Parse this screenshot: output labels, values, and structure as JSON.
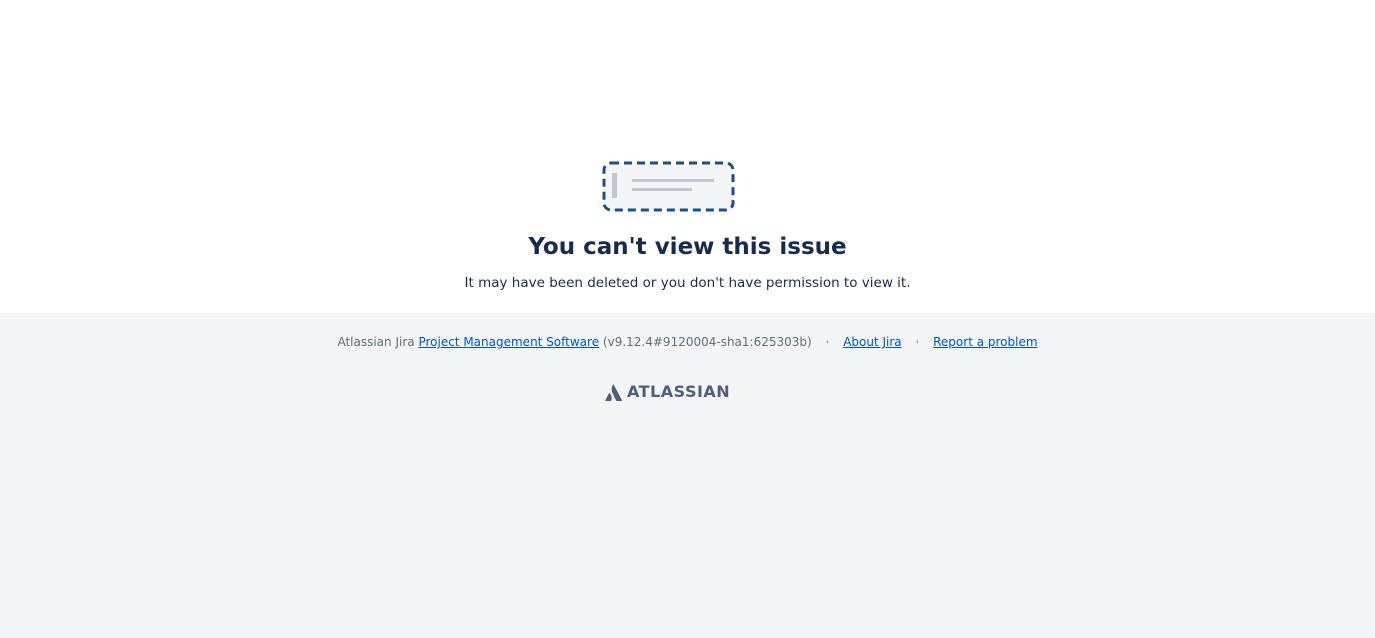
{
  "error": {
    "title": "You can't view this issue",
    "message": "It may have been deleted or you don't have permission to view it."
  },
  "footer": {
    "prefix": "Atlassian Jira",
    "pm_link": "Project Management Software",
    "version": "(v9.12.4#9120004-sha1:625303b)",
    "separator": "·",
    "about_link": "About Jira",
    "report_link": "Report a problem"
  },
  "branding": {
    "logo_text": "ATLASSIAN",
    "logo_icon": "atlassian-icon"
  },
  "colors": {
    "title": "#172b4d",
    "link": "#0052cc",
    "footer_bg": "#f4f5f7",
    "illustration_border": "#1d4e89"
  }
}
